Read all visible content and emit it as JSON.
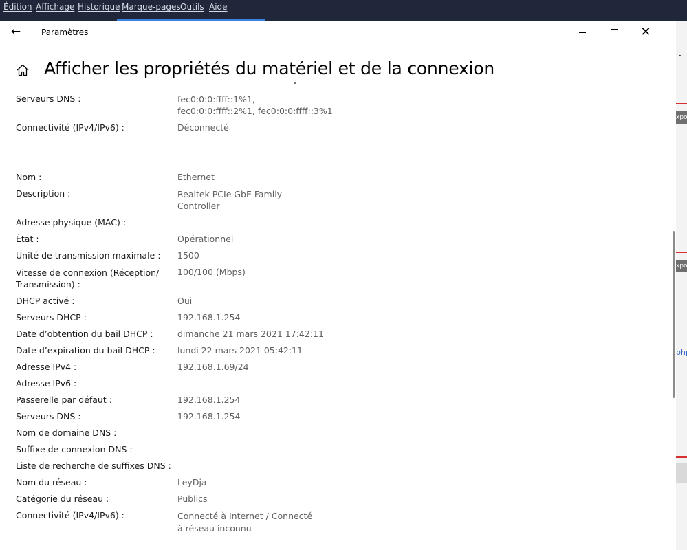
{
  "menubar": {
    "items": [
      "Édition",
      "Affichage",
      "Historique",
      "Marque-pages",
      "Outils",
      "Aide"
    ]
  },
  "background_page": {
    "fragments": [
      "it",
      "xpo",
      "xpo",
      "php"
    ]
  },
  "window": {
    "title": "Paramètres",
    "page_title": "Afficher les propriétés du matériel et de la connexion"
  },
  "rows": [
    {
      "label": "Serveurs DNS :",
      "value": "fec0:0:0:ffff::1%1,",
      "value2": "fec0:0:0:ffff::2%1, fec0:0:0:ffff::3%1"
    },
    {
      "label": "Connectivité (IPv4/IPv6) :",
      "value": "Déconnecté"
    },
    {
      "label": "Nom :",
      "value": "Ethernet"
    },
    {
      "label": "Description :",
      "value": "Realtek PCIe GbE Family",
      "value2": "Controller"
    },
    {
      "label": "Adresse physique (MAC) :",
      "value": ""
    },
    {
      "label": "État :",
      "value": "Opérationnel"
    },
    {
      "label": "Unité de transmission maximale :",
      "value": "1500"
    },
    {
      "label": "Vitesse de connexion (Réception/",
      "label2": "Transmission) :",
      "value": "100/100 (Mbps)"
    },
    {
      "label": "DHCP activé :",
      "value": "Oui"
    },
    {
      "label": "Serveurs DHCP :",
      "value": "192.168.1.254"
    },
    {
      "label": "Date d’obtention du bail DHCP :",
      "value": "dimanche 21 mars 2021 17:42:11"
    },
    {
      "label": "Date d’expiration du bail DHCP :",
      "value": "lundi 22 mars 2021 05:42:11"
    },
    {
      "label": "Adresse IPv4 :",
      "value": "192.168.1.69/24"
    },
    {
      "label": "Adresse IPv6 :",
      "value": ""
    },
    {
      "label": "Passerelle par défaut :",
      "value": "192.168.1.254"
    },
    {
      "label": "Serveurs DNS :",
      "value": "192.168.1.254"
    },
    {
      "label": "Nom de domaine DNS :",
      "value": ""
    },
    {
      "label": "Suffixe de connexion DNS :",
      "value": ""
    },
    {
      "label": "Liste de recherche de suffixes DNS :",
      "value": ""
    },
    {
      "label": "Nom du réseau :",
      "value": "LeyDja"
    },
    {
      "label": "Catégorie du réseau :",
      "value": "Publics"
    },
    {
      "label": "Connectivité (IPv4/IPv6) :",
      "value": "Connecté à Internet / Connecté",
      "value2": "à réseau inconnu"
    }
  ]
}
